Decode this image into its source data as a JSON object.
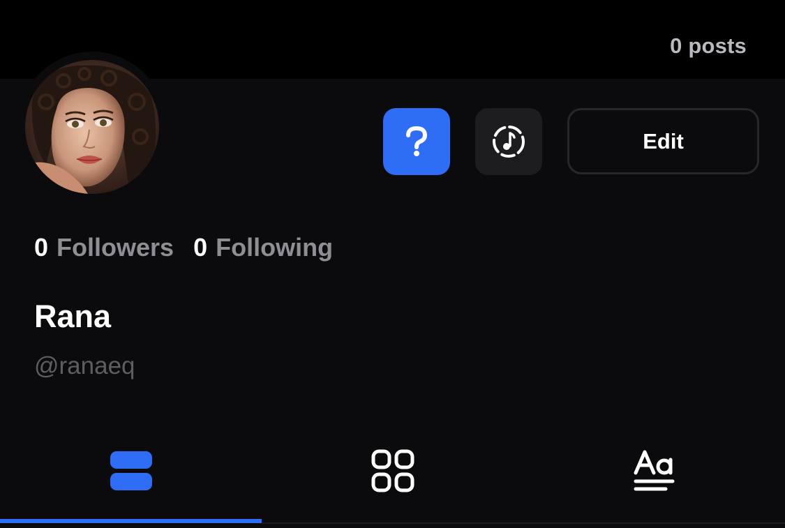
{
  "header": {
    "posts_count": "0 posts"
  },
  "profile": {
    "avatar_alt": "profile photo",
    "display_name": "Rana",
    "username": "@ranaeq",
    "followers": {
      "count": "0",
      "label": "Followers"
    },
    "following": {
      "count": "0",
      "label": "Following"
    }
  },
  "actions": {
    "help_icon": "question-mark-icon",
    "music_icon": "music-disc-icon",
    "edit_label": "Edit"
  },
  "tabs": [
    {
      "icon": "stacked-list-icon",
      "active": true
    },
    {
      "icon": "grid-icon",
      "active": false
    },
    {
      "icon": "text-aa-icon",
      "active": false
    }
  ],
  "colors": {
    "accent": "#2f6df6",
    "background": "#0b0b0e",
    "top_bar": "#000000",
    "muted_text": "#8e8e95"
  }
}
